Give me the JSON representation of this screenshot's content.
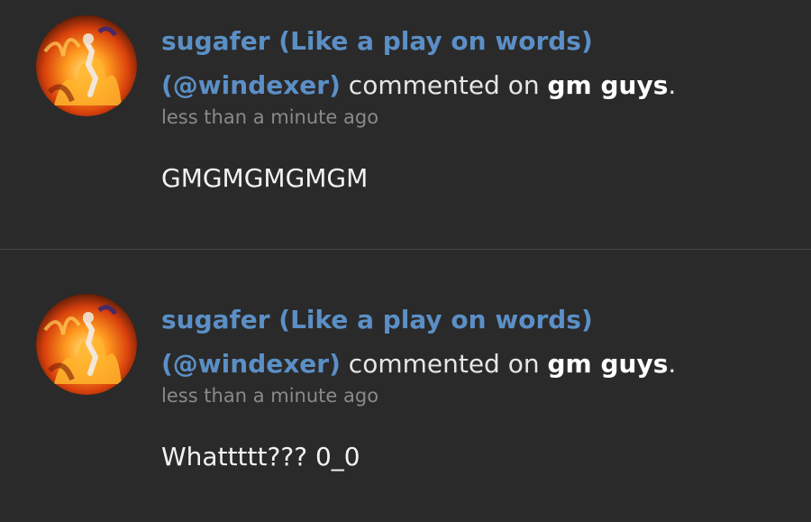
{
  "notifications": [
    {
      "display_name": "sugafer (Like a play on words)",
      "handle": "(@windexer)",
      "action": "commented on",
      "post_title": "gm guys",
      "period": ".",
      "time": "less than a minute ago",
      "comment": "GMGMGMGMGM"
    },
    {
      "display_name": "sugafer (Like a play on words)",
      "handle": "(@windexer)",
      "action": "commented on",
      "post_title": "gm guys",
      "period": ".",
      "time": "less than a minute ago",
      "comment": "Whattttt??? 0_0"
    }
  ],
  "icons": {
    "avatar": "fiery-avatar-icon"
  },
  "colors": {
    "background": "#2a2a2a",
    "username": "#5b8fc6",
    "meta": "#8a8a8a",
    "divider": "#454545"
  }
}
